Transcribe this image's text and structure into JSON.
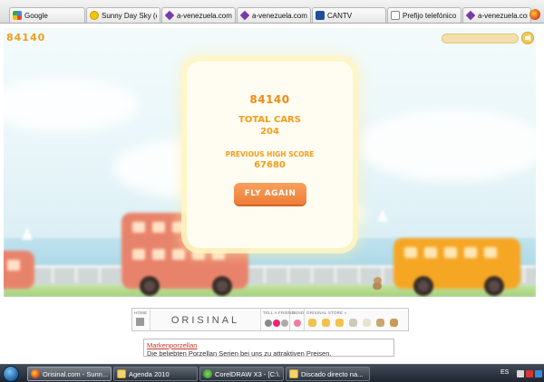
{
  "browser": {
    "tabs": [
      {
        "label": "Google",
        "icon": "google-icon"
      },
      {
        "label": "Sunny Day Sky (os...",
        "icon": "smiley-icon"
      },
      {
        "label": "a-venezuela.com -...",
        "icon": "venezuela-icon"
      },
      {
        "label": "a-venezuela.com -...",
        "icon": "venezuela-icon"
      },
      {
        "label": "CANTV",
        "icon": "cantv-icon"
      },
      {
        "label": "Prefijo telefónico ...",
        "icon": "document-icon"
      },
      {
        "label": "a-venezuela.com -...",
        "icon": "venezuela-icon"
      }
    ]
  },
  "game": {
    "top_score": "84140",
    "progress_fraction": 0.0,
    "dialog": {
      "score": "84140",
      "total_cars_label": "TOTAL CARS",
      "total_cars_value": "204",
      "prev_high_label": "PREVIOUS HIGH SCORE",
      "prev_high_value": "67680",
      "fly_again_label": "FLY AGAIN"
    },
    "colors": {
      "accent": "#f59b1c",
      "button": "#ef7d37",
      "bus_red": "#e8836b",
      "bus_orange": "#f5a623"
    }
  },
  "orisinal": {
    "home_label": "HOME",
    "logo_text": "ORISINAL",
    "tell_friend_label": "TELL A FRIEND",
    "send_label": "SEND",
    "store_label": "ORISINAL STORE »"
  },
  "ad": {
    "title": "Markenporzellan",
    "text": "Die beliebten Porzellan Serien bei uns zu attraktiven Preisen."
  },
  "taskbar": {
    "items": [
      {
        "label": "Orisinal.com - Sunn...",
        "icon": "firefox-icon",
        "active": true
      },
      {
        "label": "Agenda 2010",
        "icon": "agenda-icon",
        "active": false
      },
      {
        "label": "CorelDRAW X3 - [C:\\...",
        "icon": "coreldraw-icon",
        "active": false
      },
      {
        "label": "Discado directo na...",
        "icon": "folder-icon",
        "active": false
      }
    ],
    "language": "ES"
  }
}
